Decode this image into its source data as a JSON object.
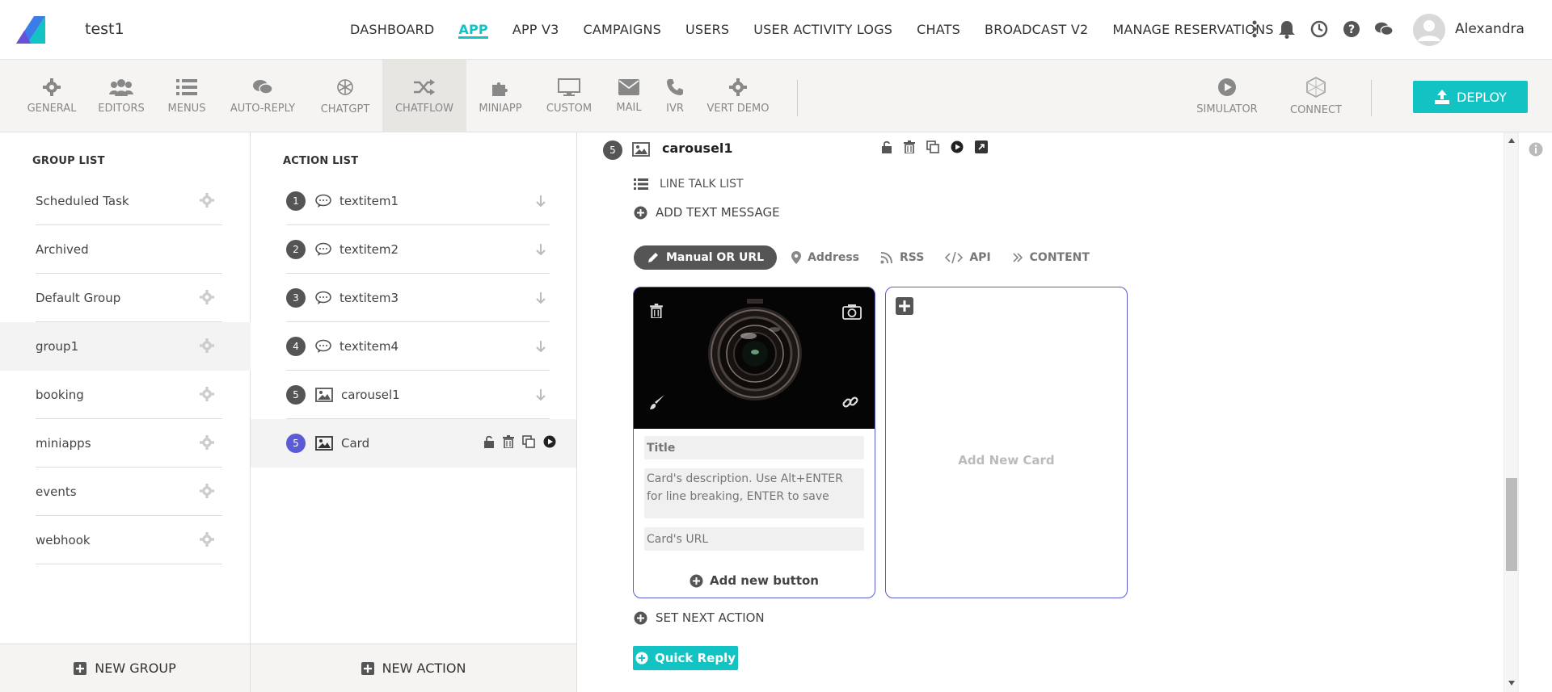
{
  "app": {
    "name": "test1",
    "user": "Alexandra"
  },
  "topnav": [
    {
      "label": "DASHBOARD",
      "active": false
    },
    {
      "label": "APP",
      "active": true
    },
    {
      "label": "APP V3",
      "active": false
    },
    {
      "label": "CAMPAIGNS",
      "active": false
    },
    {
      "label": "USERS",
      "active": false
    },
    {
      "label": "USER ACTIVITY LOGS",
      "active": false
    },
    {
      "label": "CHATS",
      "active": false
    },
    {
      "label": "BROADCAST V2",
      "active": false
    },
    {
      "label": "MANAGE RESERVATIONS",
      "active": false
    }
  ],
  "toolbar": {
    "items": [
      "GENERAL",
      "EDITORS",
      "MENUS",
      "AUTO-REPLY",
      "CHATGPT",
      "CHATFLOW",
      "MINIAPP",
      "CUSTOM",
      "MAIL",
      "IVR",
      "VERT DEMO"
    ],
    "active": "CHATFLOW",
    "simulator": "SIMULATOR",
    "connect": "CONNECT",
    "deploy": "DEPLOY"
  },
  "groups": {
    "title": "GROUP LIST",
    "items": [
      "Scheduled Task",
      "Archived",
      "Default Group",
      "group1",
      "booking",
      "miniapps",
      "events",
      "webhook"
    ],
    "active": "group1",
    "new_label": "NEW GROUP"
  },
  "actions": {
    "title": "ACTION LIST",
    "items": [
      {
        "num": "1",
        "label": "textitem1",
        "type": "text"
      },
      {
        "num": "2",
        "label": "textitem2",
        "type": "text"
      },
      {
        "num": "3",
        "label": "textitem3",
        "type": "text"
      },
      {
        "num": "4",
        "label": "textitem4",
        "type": "text"
      },
      {
        "num": "5",
        "label": "carousel1",
        "type": "image"
      },
      {
        "num": "5",
        "label": "Card",
        "type": "image"
      }
    ],
    "new_label": "NEW ACTION"
  },
  "editor": {
    "step_num": "5",
    "step_title": "carousel1",
    "line_talk": "LINE TALK LIST",
    "add_text": "ADD TEXT MESSAGE",
    "tabs": [
      "Manual OR URL",
      "Address",
      "RSS",
      "API",
      "CONTENT"
    ],
    "card": {
      "title_placeholder": "Title",
      "desc_placeholder": "Card's description. Use Alt+ENTER for line breaking, ENTER to save",
      "url_placeholder": "Card's URL",
      "add_button": "Add new button"
    },
    "new_card": "Add New Card",
    "set_next": "SET NEXT ACTION",
    "quick_reply": "Quick Reply"
  }
}
